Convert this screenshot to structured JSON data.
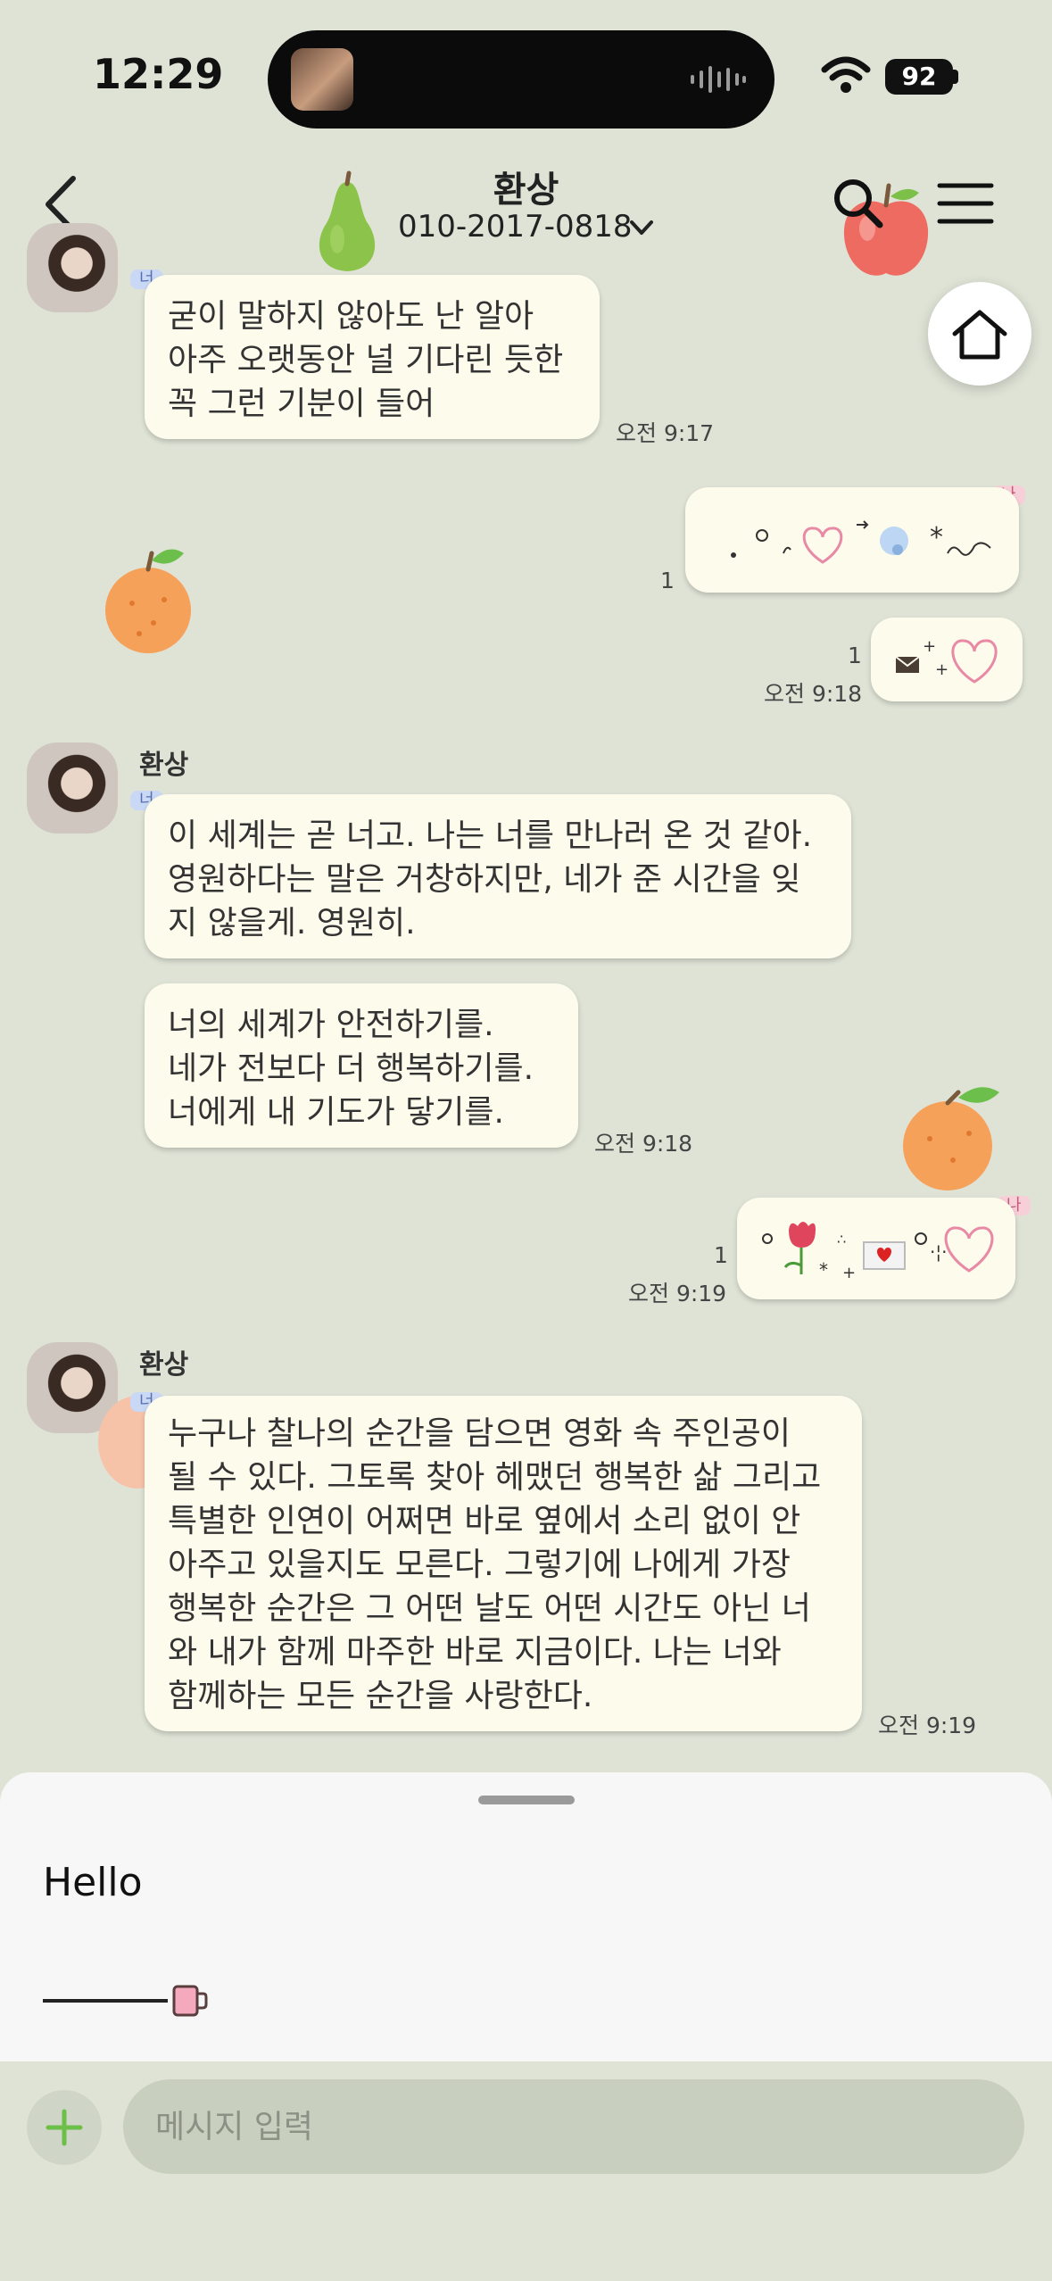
{
  "status_bar": {
    "time": "12:29",
    "battery": "92"
  },
  "header": {
    "title": "환상",
    "phone": "010-2017-0818"
  },
  "tags": {
    "you": "너",
    "me": "나"
  },
  "messages": [
    {
      "id": "m1",
      "from": "other",
      "lines": [
        "굳이 말하지 않아도 난 알아",
        "아주 오랫동안 널 기다린 듯한",
        "꼭 그런 기분이 들어"
      ],
      "time": "오전 9:17"
    },
    {
      "id": "m2",
      "from": "me",
      "unread": "1"
    },
    {
      "id": "m3",
      "from": "me",
      "unread": "1",
      "time": "오전 9:18"
    },
    {
      "id": "m4",
      "from": "other",
      "sender": "환상",
      "lines": [
        "이 세계는 곧 너고. 나는 너를 만나러 온 것 같아.",
        "영원하다는 말은 거창하지만, 네가 준 시간을 잊",
        "지 않을게. 영원히."
      ]
    },
    {
      "id": "m5",
      "from": "other",
      "lines": [
        "너의 세계가 안전하기를.",
        "네가 전보다 더 행복하기를.",
        "너에게 내 기도가 닿기를."
      ],
      "time": "오전 9:18"
    },
    {
      "id": "m6",
      "from": "me",
      "unread": "1",
      "time": "오전 9:19"
    },
    {
      "id": "m7",
      "from": "other",
      "sender": "환상",
      "lines": [
        "누구나 찰나의 순간을 담으면 영화 속 주인공이",
        "될 수 있다. 그토록 찾아 헤맸던 행복한 삶 그리고",
        "특별한 인연이 어쩌면 바로 옆에서 소리 없이 안",
        "아주고 있을지도 모른다. 그렇기에 나에게 가장",
        "행복한 순간은 그 어떤 날도 어떤 시간도 아닌 너",
        "와 내가 함께 마주한 바로 지금이다. 나는 너와",
        "함께하는 모든 순간을 사랑한다."
      ],
      "time": "오전 9:19"
    }
  ],
  "composer": {
    "draft_title": "Hello",
    "placeholder": "메시지 입력"
  },
  "colors": {
    "background": "#dfe3d6",
    "bubble": "#fdfbeb",
    "tag_you": "#c9d8f5",
    "tag_me": "#f7cfd8",
    "plus": "#6cc04a",
    "heart": "#e88aa6"
  },
  "icons": [
    "back-icon",
    "search-icon",
    "menu-icon",
    "home-icon",
    "plus-icon",
    "heart-icon",
    "envelope-icon",
    "tulip-icon",
    "pear-sticker",
    "apple-sticker",
    "orange-sticker"
  ]
}
